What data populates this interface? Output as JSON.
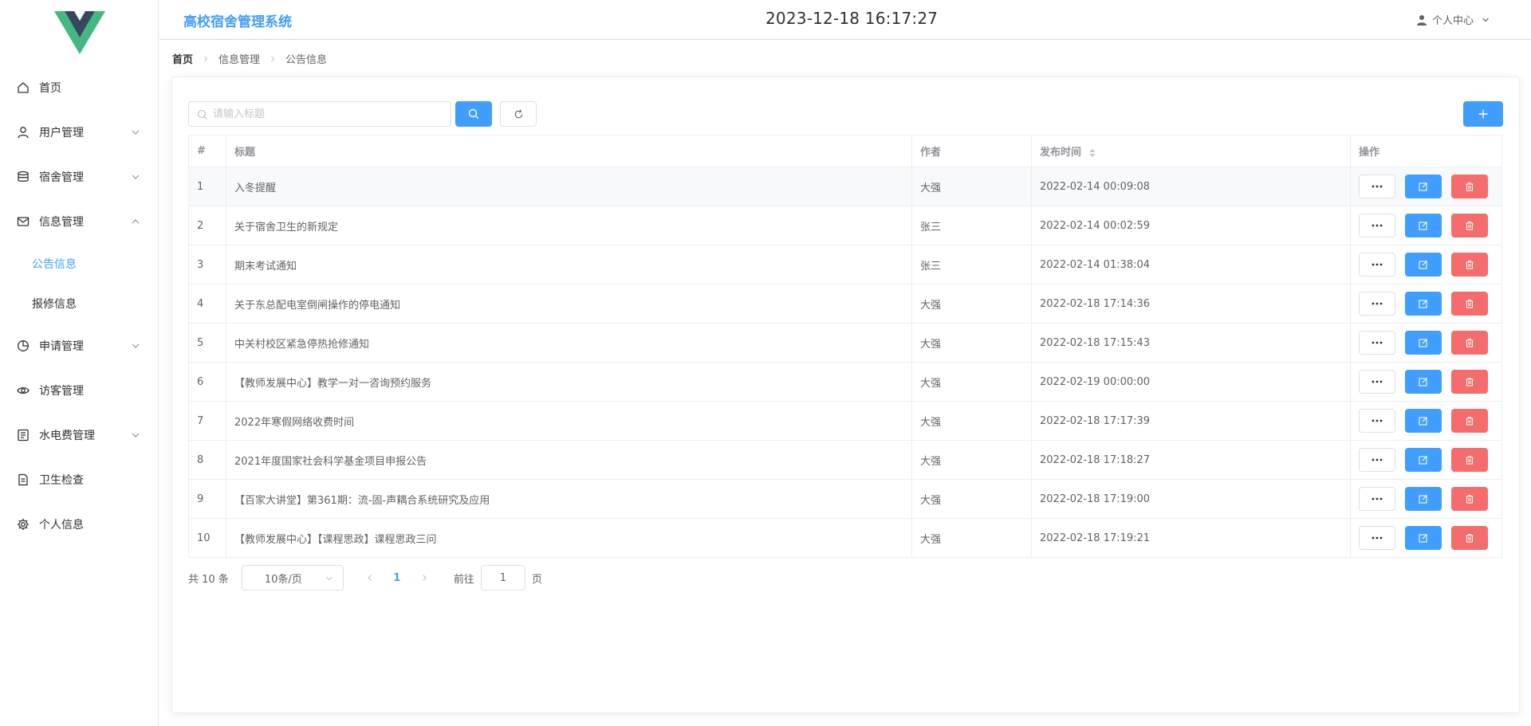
{
  "header": {
    "system_title": "高校宿舍管理系统",
    "clock": "2023-12-18 16:17:27",
    "user_menu_label": "个人中心"
  },
  "sidebar": {
    "items": [
      {
        "label": "首页",
        "icon": "home-icon"
      },
      {
        "label": "用户管理",
        "icon": "user-icon"
      },
      {
        "label": "宿舍管理",
        "icon": "database-icon"
      },
      {
        "label": "信息管理",
        "icon": "message-icon"
      },
      {
        "label": "申请管理",
        "icon": "pie-chart-icon"
      },
      {
        "label": "访客管理",
        "icon": "eye-icon"
      },
      {
        "label": "水电费管理",
        "icon": "bill-icon"
      },
      {
        "label": "卫生检查",
        "icon": "document-icon"
      },
      {
        "label": "个人信息",
        "icon": "gear-icon"
      }
    ],
    "sub_items": [
      {
        "label": "公告信息",
        "active": true
      },
      {
        "label": "报修信息",
        "active": false
      }
    ]
  },
  "breadcrumb": [
    "首页",
    "信息管理",
    "公告信息"
  ],
  "search": {
    "placeholder": "请输入标题",
    "value": ""
  },
  "table": {
    "headers": [
      "#",
      "标题",
      "作者",
      "发布时间",
      "操作"
    ],
    "rows": [
      {
        "idx": "1",
        "title": "入冬提醒",
        "author": "大强",
        "time": "2022-02-14 00:09:08"
      },
      {
        "idx": "2",
        "title": "关于宿舍卫生的新规定",
        "author": "张三",
        "time": "2022-02-14 00:02:59"
      },
      {
        "idx": "3",
        "title": "期末考试通知",
        "author": "张三",
        "time": "2022-02-14 01:38:04"
      },
      {
        "idx": "4",
        "title": "关于东总配电室倒闸操作的停电通知",
        "author": "大强",
        "time": "2022-02-18 17:14:36"
      },
      {
        "idx": "5",
        "title": "中关村校区紧急停热抢修通知",
        "author": "大强",
        "time": "2022-02-18 17:15:43"
      },
      {
        "idx": "6",
        "title": "【教师发展中心】教学一对一咨询预约服务",
        "author": "大强",
        "time": "2022-02-19 00:00:00"
      },
      {
        "idx": "7",
        "title": "2022年寒假网络收费时间",
        "author": "大强",
        "time": "2022-02-18 17:17:39"
      },
      {
        "idx": "8",
        "title": "2021年度国家社会科学基金项目申报公告",
        "author": "大强",
        "time": "2022-02-18 17:18:27"
      },
      {
        "idx": "9",
        "title": "【百家大讲堂】第361期：流-固-声耦合系统研究及应用",
        "author": "大强",
        "time": "2022-02-18 17:19:00"
      },
      {
        "idx": "10",
        "title": "【教师发展中心】【课程思政】课程思政三问",
        "author": "大强",
        "time": "2022-02-18 17:19:21"
      }
    ]
  },
  "pagination": {
    "total_label": "共 10 条",
    "page_size_label": "10条/页",
    "current_page": "1",
    "goto_prefix": "前往",
    "goto_value": "1",
    "goto_suffix": "页"
  },
  "colors": {
    "primary": "#409eff",
    "danger": "#f56c6c",
    "text": "#606266"
  }
}
